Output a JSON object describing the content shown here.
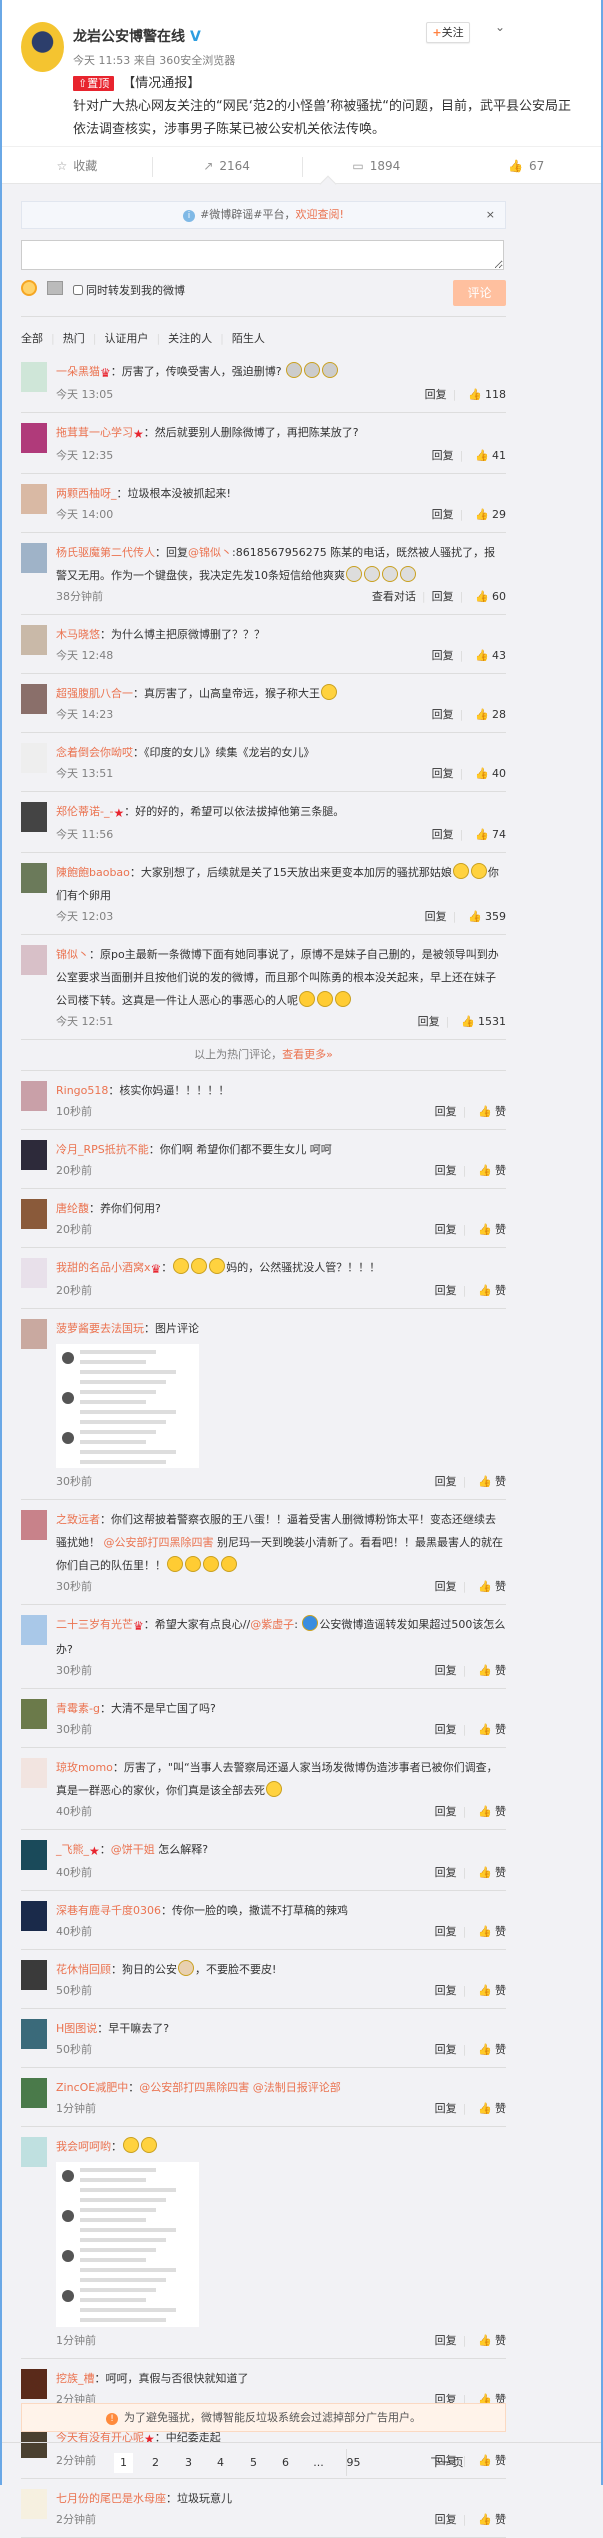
{
  "post": {
    "author": "龙岩公安博警在线",
    "verified_mark": "V",
    "follow_label": "关注",
    "time": "今天 11:53",
    "source": "来自 360安全浏览器",
    "pinned_label": "置顶",
    "title": "【情况通报】",
    "body": "针对广大热心网友关注的“网民‘范2的小怪兽’称被骚扰“的问题，目前，武平县公安局正依法调查核实，涉事男子陈某已被公安机关依法传唤。",
    "actions": {
      "favorite": "收藏",
      "repost": "2164",
      "comment": "1894",
      "like": "67"
    }
  },
  "notice": {
    "text": "#微博辟谣#平台，",
    "highlight": "欢迎查阅!",
    "close": "×"
  },
  "composer": {
    "input_value": "",
    "repost_checkbox_label": "同时转发到我的微博",
    "submit_label": "评论"
  },
  "filter_tabs": [
    "全部",
    "热门",
    "认证用户",
    "关注的人",
    "陌生人"
  ],
  "colors": {
    "accent": "#eb7350",
    "name": "#eb7350",
    "bg": "#f2f2f5"
  },
  "hot_comments": [
    {
      "name": "一朵黑猫",
      "badge": "crown",
      "content": [
        {
          "t": "厉害了，传唤受害人，强迫删博? "
        },
        {
          "e": "#ccc",
          "n": 3
        }
      ],
      "time": "今天 13:05",
      "likes": "118",
      "avatar_color": "#cfe6d8"
    },
    {
      "name": "拖茸茸一心学习",
      "badge": "star",
      "content": [
        {
          "t": "然后就要别人删除微博了，再把陈某放了?"
        }
      ],
      "time": "今天 12:35",
      "likes": "41",
      "avatar_color": "#b03a7a"
    },
    {
      "name": "两颗西柚呀_",
      "content": [
        {
          "t": "垃圾根本没被抓起来!"
        }
      ],
      "time": "今天 14:00",
      "likes": "29",
      "avatar_color": "#d9b9a4"
    },
    {
      "name": "杨氏驱魔第二代传人",
      "content": [
        {
          "t": "回复"
        },
        {
          "m": "@锦似丶"
        },
        {
          "t": ":8618567956275 陈某的电话，既然被人骚扰了，报警又无用。作为一个键盘侠，我决定先发10条短信给他爽爽"
        },
        {
          "e": "#ddd",
          "n": 4
        }
      ],
      "time": "38分钟前",
      "view_dialog": "查看对话",
      "likes": "60",
      "avatar_color": "#9fb3c8"
    },
    {
      "name": "木马晓悠",
      "content": [
        {
          "t": "为什么博主把原微博删了？？？"
        }
      ],
      "time": "今天 12:48",
      "likes": "43",
      "avatar_color": "#c9b9a8"
    },
    {
      "name": "超强腹肌八合一",
      "content": [
        {
          "t": "真厉害了，山高皇帝远，猴子称大王"
        },
        {
          "e": "#ffd23f",
          "n": 1
        }
      ],
      "time": "今天 14:23",
      "likes": "28",
      "avatar_color": "#8a6f6a"
    },
    {
      "name": "念着倒会你呦哎",
      "content": [
        {
          "t": "《印度的女儿》续集《龙岩的女儿》"
        }
      ],
      "time": "今天 13:51",
      "likes": "40",
      "avatar_color": "#eeeeee"
    },
    {
      "name": "郑伦蒂诺-_-",
      "badge": "star",
      "content": [
        {
          "t": "好的好的，希望可以依法拔掉他第三条腿。"
        }
      ],
      "time": "今天 11:56",
      "likes": "74",
      "avatar_color": "#444444"
    },
    {
      "name": "陳飽飽baobao",
      "content": [
        {
          "t": "大家别想了，后续就是关了15天放出来更变本加厉的骚扰那姑娘"
        },
        {
          "e": "#ffd23f",
          "n": 2
        },
        {
          "t": "你们有个卵用"
        }
      ],
      "time": "今天 12:03",
      "likes": "359",
      "avatar_color": "#6b7a5a"
    },
    {
      "name": "锦似丶",
      "content": [
        {
          "t": "原po主最新一条微博下面有她同事说了，原博不是妹子自己删的，是被领导叫到办公室要求当面删并且按他们说的发的微博，而且那个叫陈勇的根本没关起来，早上还在妹子公司楼下转。这真是一件让人恶心的事恶心的人呢"
        },
        {
          "e": "#ffcc33",
          "n": 3
        }
      ],
      "time": "今天 12:51",
      "likes": "1531",
      "avatar_color": "#d8c0c8"
    }
  ],
  "hot_more": {
    "text": "以上为热门评论，",
    "link": "查看更多»"
  },
  "reply_label": "回复",
  "like_label": "赞",
  "new_comments": [
    {
      "name": "Ringo518",
      "content": [
        {
          "t": "核实你妈逼！！！！！"
        }
      ],
      "time": "10秒前",
      "avatar_color": "#c9a0a8"
    },
    {
      "name": "冷月_RPS抵抗不能",
      "content": [
        {
          "t": "你们啊 希望你们都不要生女儿 呵呵"
        }
      ],
      "time": "20秒前",
      "avatar_color": "#2d2a3a"
    },
    {
      "name": "唐纶馥",
      "content": [
        {
          "t": "养你们何用?"
        }
      ],
      "time": "20秒前",
      "avatar_color": "#8a5a3a"
    },
    {
      "name": "我甜的名品小酒窝x",
      "badge": "crown",
      "content": [
        {
          "e": "#ffd23f",
          "n": 3
        },
        {
          "t": "妈的，公然骚扰没人管？！！！"
        }
      ],
      "time": "20秒前",
      "avatar_color": "#e8e0ea"
    },
    {
      "name": "菠萝酱要去法国玩",
      "content": [
        {
          "t": "图片评论"
        }
      ],
      "image": "short",
      "time": "30秒前",
      "avatar_color": "#c9a9a0"
    },
    {
      "name": "之致远者",
      "content": [
        {
          "t": "你们这帮披着警察衣服的王八蛋！！逼着受害人删微博粉饰太平！变态还继续去骚扰她！ "
        },
        {
          "m": "@公安部打四黑除四害"
        },
        {
          "t": " 别尼玛一天到晚装小清新了。看看吧！！最黑最害人的就在你们自己的队伍里！！"
        },
        {
          "e": "#ffcc33",
          "n": 4
        }
      ],
      "time": "30秒前",
      "avatar_color": "#c8828a"
    },
    {
      "name": "二十三岁有光芒",
      "badge": "crown",
      "content": [
        {
          "t": "希望大家有点良心//"
        },
        {
          "m": "@紫虚子"
        },
        {
          "t": ": "
        },
        {
          "e": "#3a8de0",
          "n": 1
        },
        {
          "t": "公安微博造谣转发如果超过500该怎么办?"
        }
      ],
      "time": "30秒前",
      "avatar_color": "#a9c8e8"
    },
    {
      "name": "青霉素-g",
      "content": [
        {
          "t": "大清不是早亡国了吗?"
        }
      ],
      "time": "30秒前",
      "avatar_color": "#6b7a4a"
    },
    {
      "name": "琼玫momo",
      "content": [
        {
          "t": "厉害了，\"叫“当事人去警察局还逼人家当场发微博伪造涉事者已被你们调查，真是一群恶心的家伙，你们真是该全部去死"
        },
        {
          "e": "#ffd23f",
          "n": 1
        }
      ],
      "time": "40秒前",
      "avatar_color": "#f2e4e0"
    },
    {
      "name": "_飞熊_",
      "badge": "star",
      "content": [
        {
          "m": "@饼干姐"
        },
        {
          "t": " 怎么解释?"
        }
      ],
      "time": "40秒前",
      "avatar_color": "#1a4a5a"
    },
    {
      "name": "深巷有鹿寻千度0306",
      "content": [
        {
          "t": "传你一脸的唤，撒谎不打草稿的辣鸡"
        }
      ],
      "time": "40秒前",
      "avatar_color": "#1a2a4a"
    },
    {
      "name": "花休悄回顾",
      "content": [
        {
          "t": "狗日的公安"
        },
        {
          "e": "#e8d0b0",
          "n": 1
        },
        {
          "t": "，不要脸不要皮!"
        }
      ],
      "time": "50秒前",
      "avatar_color": "#3a3a3a"
    },
    {
      "name": "H图图说",
      "content": [
        {
          "t": "早干嘛去了?"
        }
      ],
      "time": "50秒前",
      "avatar_color": "#3a6a7a"
    },
    {
      "name": "ZincOE减肥中",
      "content": [
        {
          "m": "@公安部打四黑除四害 @法制日报评论部"
        }
      ],
      "time": "1分钟前",
      "avatar_color": "#4a7a4a"
    },
    {
      "name": "我会呵呵哟",
      "content": [
        {
          "e": "#ffd23f",
          "n": 2
        }
      ],
      "image": "tall",
      "time": "1分钟前",
      "avatar_color": "#bfe0e0"
    },
    {
      "name": "挖族_槽",
      "content": [
        {
          "t": "呵呵，真假与否很快就知道了"
        }
      ],
      "time": "2分钟前",
      "avatar_color": "#5a2a1a"
    },
    {
      "name": "今天有没有开心呢",
      "badge": "star",
      "content": [
        {
          "t": "中纪委走起"
        }
      ],
      "time": "2分钟前",
      "avatar_color": "#4a4030"
    },
    {
      "name": "七月份的尾巴是水母座",
      "content": [
        {
          "t": "垃圾玩意儿"
        }
      ],
      "time": "2分钟前",
      "avatar_color": "#f6f0e0"
    }
  ],
  "warning": {
    "icon": "!",
    "text": "为了避免骚扰，微博智能反垃圾系统会过滤掉部分广告用户。"
  },
  "pagination": {
    "pages": [
      "1",
      "2",
      "3",
      "4",
      "5",
      "6",
      "...",
      "95"
    ],
    "current": "1",
    "next": "下一页"
  }
}
